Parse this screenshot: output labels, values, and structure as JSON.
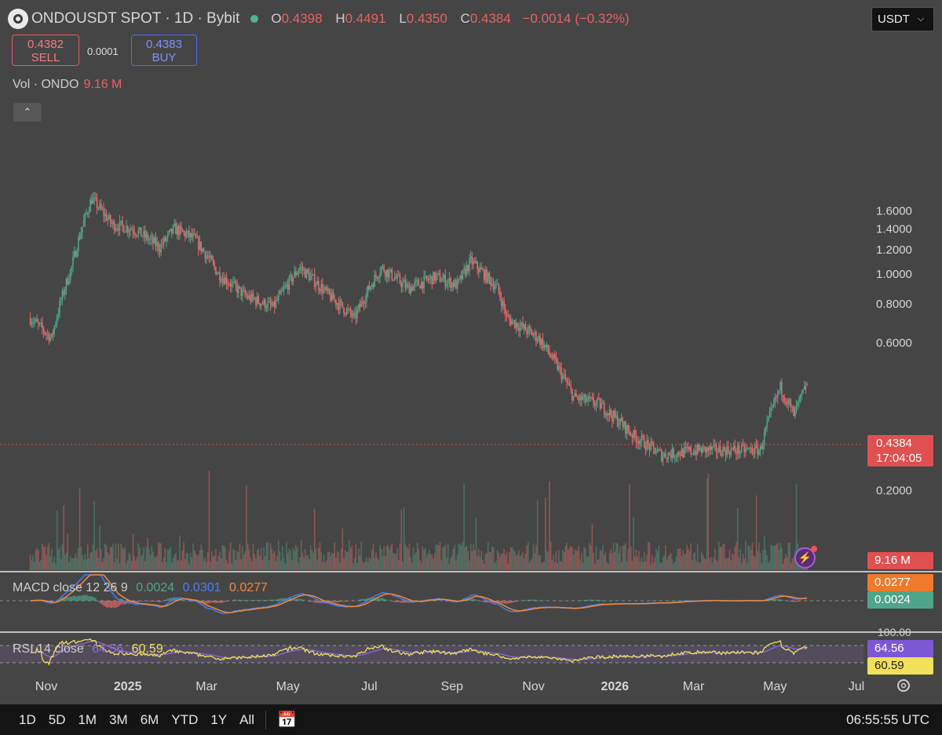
{
  "header": {
    "symbol": "ONDOUSDT SPOT · 1D · Bybit",
    "ohlc": {
      "o_label": "O",
      "o": "0.4398",
      "h_label": "H",
      "h": "0.4491",
      "l_label": "L",
      "l": "0.4350",
      "c_label": "C",
      "c": "0.4384",
      "change": "−0.0014 (−0.32%)"
    }
  },
  "trade": {
    "sell_price": "0.4382",
    "sell_label": "SELL",
    "spread": "0.0001",
    "buy_price": "0.4383",
    "buy_label": "BUY"
  },
  "currency": {
    "label": "USDT"
  },
  "volume": {
    "label": "Vol · ONDO",
    "value": "9.16 M",
    "badge": "9.16 M"
  },
  "macd": {
    "label": "MACD close 12 26 9",
    "hist": "0.0024",
    "macd": "0.0301",
    "signal": "0.0277",
    "badge_signal": "0.0277",
    "badge_hist": "0.0024"
  },
  "rsi": {
    "label": "RSI 14 close",
    "rsi": "64.56",
    "ma": "60.59",
    "badge_rsi": "64.56",
    "badge_ma": "60.59",
    "level": "100.00"
  },
  "price_axis": [
    "1.6000",
    "1.4000",
    "1.2000",
    "1.0000",
    "0.8000",
    "0.6000",
    "0.2000"
  ],
  "last_price": {
    "value": "0.4384",
    "countdown": "17:04:05"
  },
  "time_axis": [
    {
      "label": "Nov",
      "bold": false
    },
    {
      "label": "2025",
      "bold": true
    },
    {
      "label": "Mar",
      "bold": false
    },
    {
      "label": "May",
      "bold": false
    },
    {
      "label": "Jul",
      "bold": false
    },
    {
      "label": "Sep",
      "bold": false
    },
    {
      "label": "Nov",
      "bold": false
    },
    {
      "label": "2026",
      "bold": true
    },
    {
      "label": "Mar",
      "bold": false
    },
    {
      "label": "May",
      "bold": false
    },
    {
      "label": "Jul",
      "bold": false
    }
  ],
  "ranges": [
    "1D",
    "5D",
    "1M",
    "3M",
    "6M",
    "YTD",
    "1Y",
    "All"
  ],
  "clock": "06:55:55 UTC",
  "colors": {
    "up": "#4fa58a",
    "down": "#e46a6a",
    "background": "#454545",
    "macd": "#4a7cf0",
    "signal": "#ef8a3c",
    "rsi": "#f1e05a",
    "rsi_ma": "#8f6ad8"
  },
  "chart_data": {
    "type": "candlestick",
    "ylim": [
      0.15,
      1.8
    ],
    "close_path": [
      {
        "t": "2024-10-20",
        "v": 0.72
      },
      {
        "t": "2024-11-05",
        "v": 0.62
      },
      {
        "t": "2024-11-20",
        "v": 1.05
      },
      {
        "t": "2024-12-05",
        "v": 1.75
      },
      {
        "t": "2024-12-20",
        "v": 1.45
      },
      {
        "t": "2025-01-05",
        "v": 1.4
      },
      {
        "t": "2025-01-25",
        "v": 1.22
      },
      {
        "t": "2025-02-05",
        "v": 1.4
      },
      {
        "t": "2025-02-20",
        "v": 1.3
      },
      {
        "t": "2025-03-10",
        "v": 1.0
      },
      {
        "t": "2025-03-30",
        "v": 0.85
      },
      {
        "t": "2025-04-20",
        "v": 0.78
      },
      {
        "t": "2025-05-10",
        "v": 1.05
      },
      {
        "t": "2025-06-01",
        "v": 0.85
      },
      {
        "t": "2025-06-20",
        "v": 0.72
      },
      {
        "t": "2025-07-10",
        "v": 1.05
      },
      {
        "t": "2025-07-30",
        "v": 0.9
      },
      {
        "t": "2025-08-20",
        "v": 0.98
      },
      {
        "t": "2025-09-05",
        "v": 0.92
      },
      {
        "t": "2025-09-15",
        "v": 1.1
      },
      {
        "t": "2025-10-05",
        "v": 0.9
      },
      {
        "t": "2025-10-12",
        "v": 0.72
      },
      {
        "t": "2025-11-05",
        "v": 0.62
      },
      {
        "t": "2025-12-01",
        "v": 0.4
      },
      {
        "t": "2025-12-20",
        "v": 0.38
      },
      {
        "t": "2026-01-15",
        "v": 0.3
      },
      {
        "t": "2026-02-05",
        "v": 0.26
      },
      {
        "t": "2026-03-05",
        "v": 0.27
      },
      {
        "t": "2026-04-20",
        "v": 0.27
      },
      {
        "t": "2026-05-05",
        "v": 0.43
      },
      {
        "t": "2026-05-15",
        "v": 0.35
      },
      {
        "t": "2026-05-25",
        "v": 0.4384
      }
    ]
  }
}
